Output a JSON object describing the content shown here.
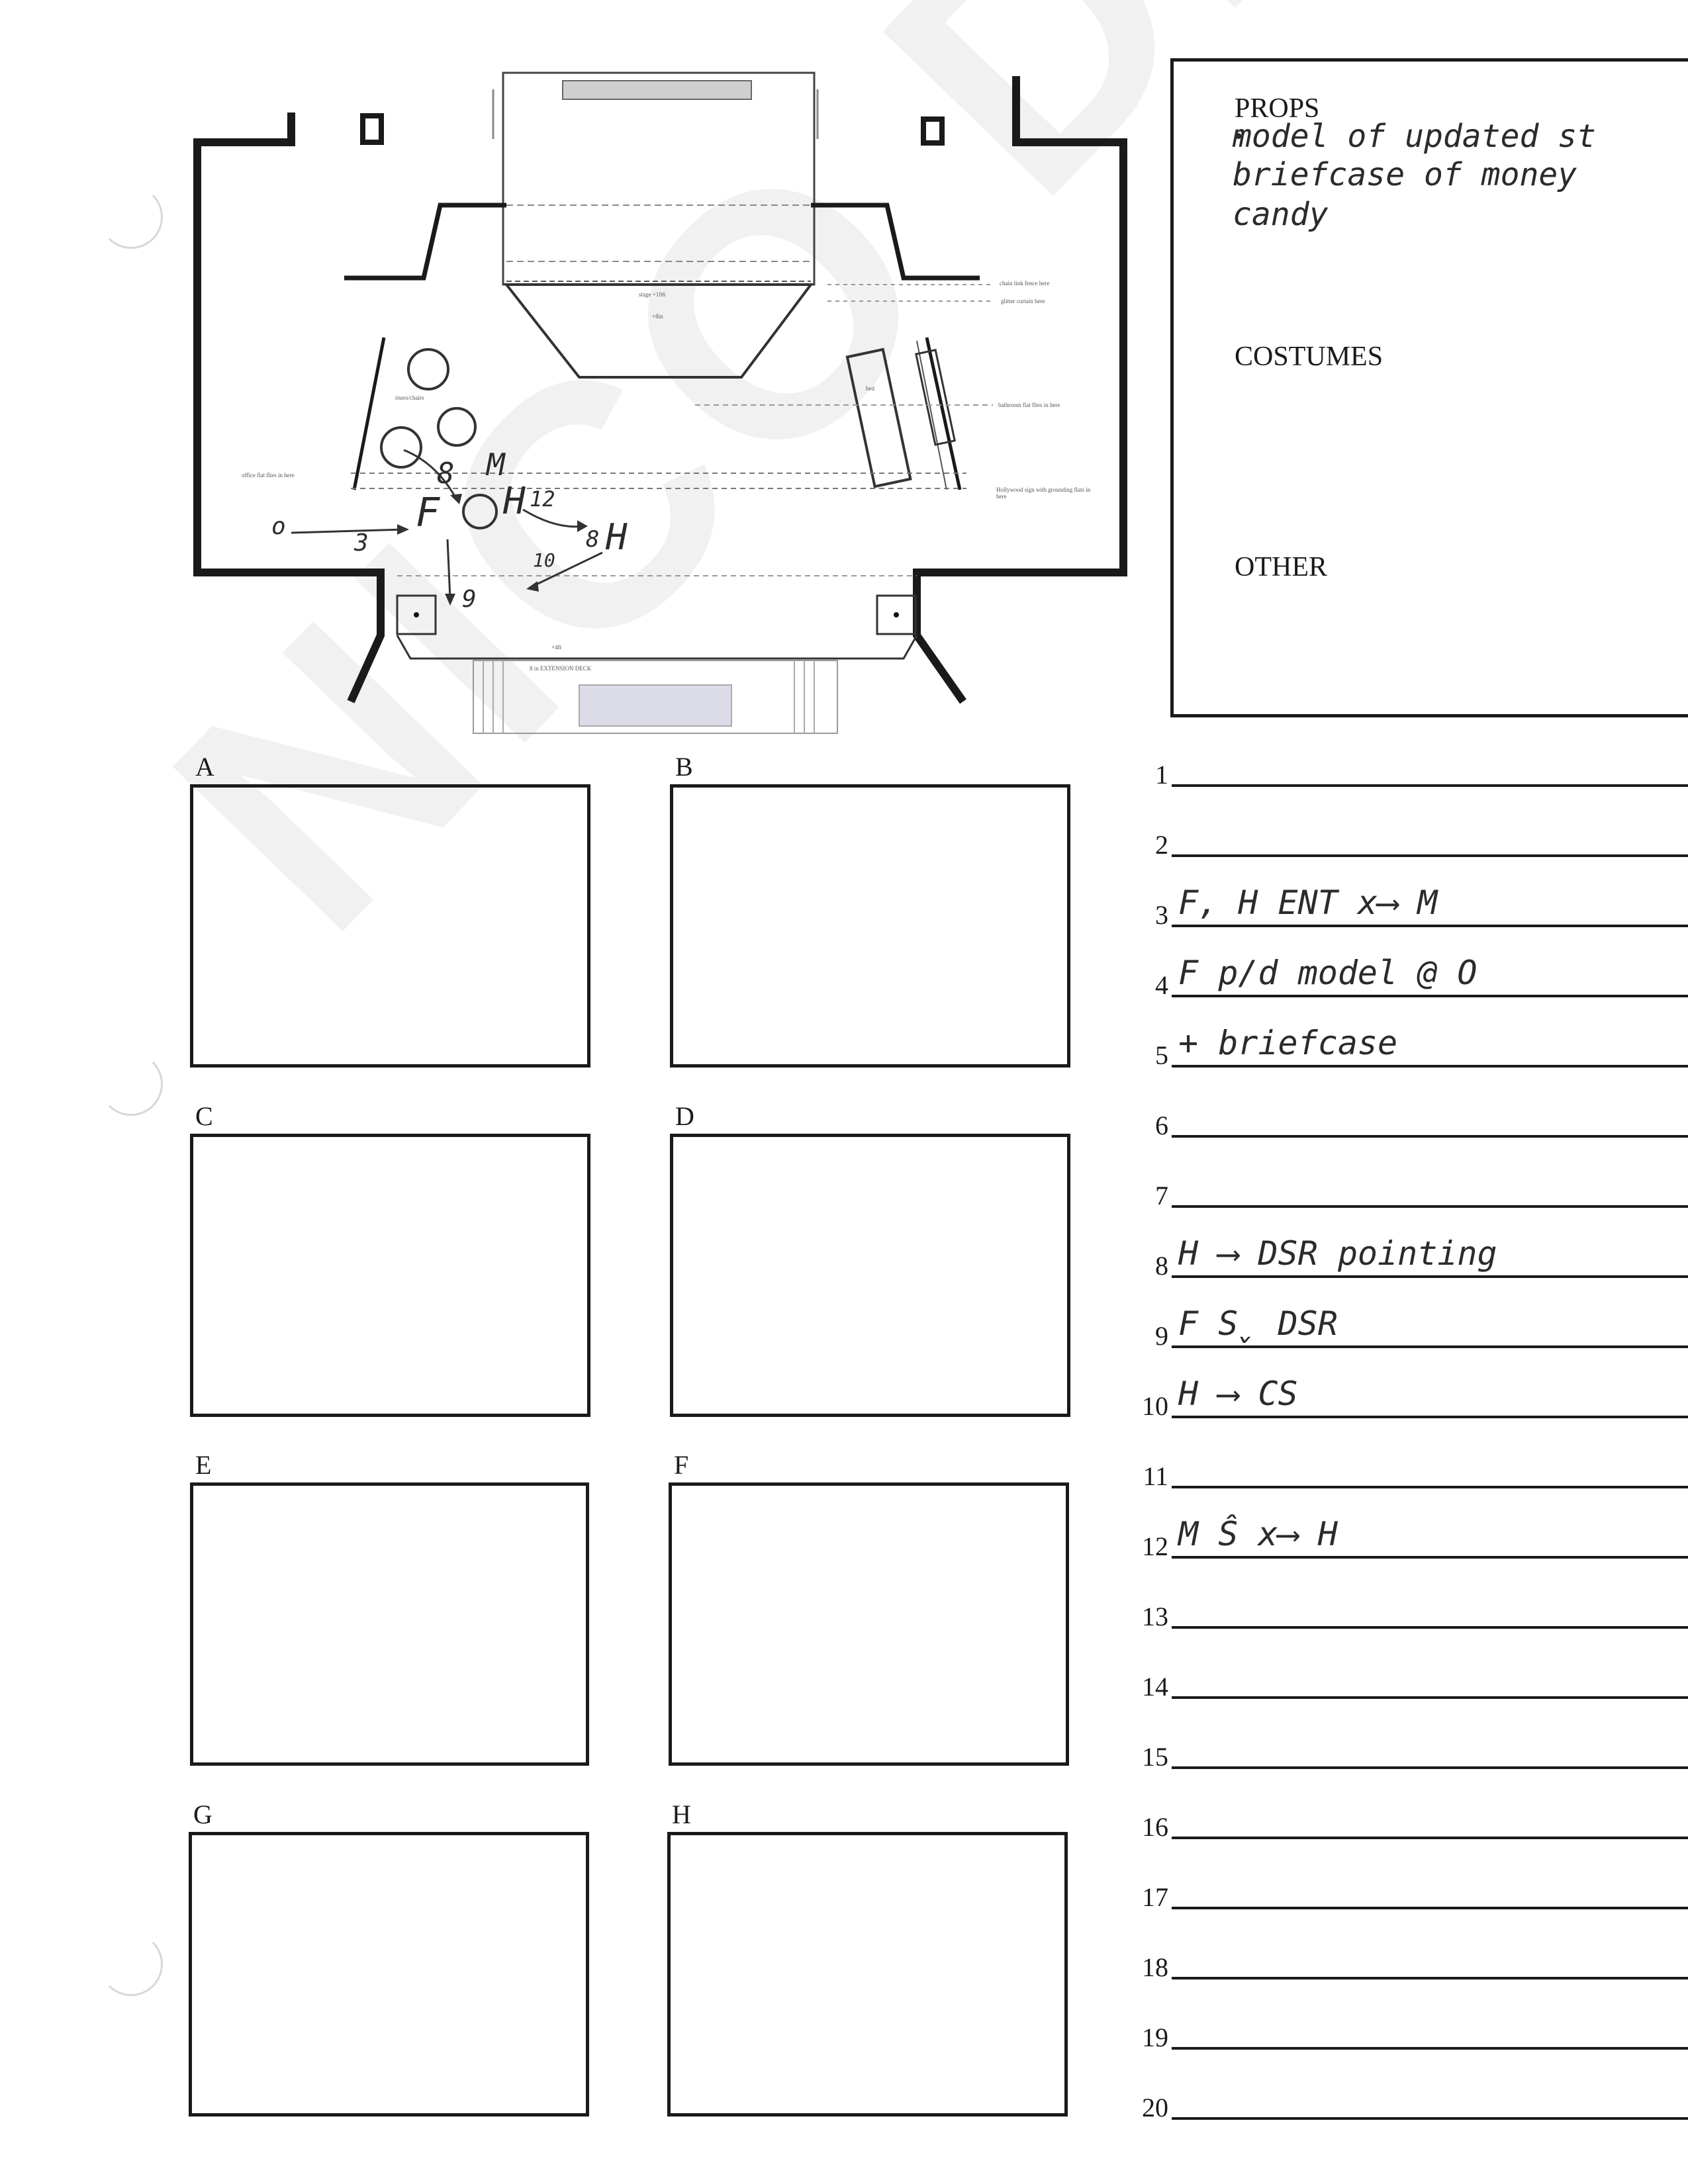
{
  "watermark": "NICO DICECCO",
  "stage_plan": {
    "labels": {
      "chain_link": "chain link fence here",
      "glitter": "glitter curtain here",
      "stage_label": "stage +1ft6",
      "plus_8": "+8in",
      "office_flat": "office flat flies in here",
      "bathroom_flat": "bathroom flat flies in here",
      "hollywood": "Hollywood sign with grounding flats in here",
      "bed": "bed",
      "risers": "risers/chairs",
      "plus_4": "+4ft",
      "extension": "8 in EXTENSION DECK"
    },
    "blocking": {
      "o_start": "o",
      "arrow_3": "3",
      "F": "F",
      "O": "O",
      "8_label": "8",
      "M": "M",
      "H_label": "H",
      "arrow_12": "12",
      "arrow_8": "8",
      "arrow_9": "9",
      "arrow_10": "10"
    }
  },
  "sidebar_box": {
    "props_title": "PROPS",
    "props_items": [
      "model of updated st",
      "briefcase of money",
      "candy"
    ],
    "costumes_title": "COSTUMES",
    "other_title": "OTHER"
  },
  "frames": [
    "A",
    "B",
    "C",
    "D",
    "E",
    "F",
    "G",
    "H"
  ],
  "lines": [
    {
      "num": "1",
      "text": ""
    },
    {
      "num": "2",
      "text": ""
    },
    {
      "num": "3",
      "text": "F, H      ENT  x⟶   M"
    },
    {
      "num": "4",
      "text": "F   p/d  model  @   O"
    },
    {
      "num": "5",
      "text": "+   briefcase"
    },
    {
      "num": "6",
      "text": ""
    },
    {
      "num": "7",
      "text": ""
    },
    {
      "num": "8",
      "text": "H ⟶ DSR   pointing"
    },
    {
      "num": "9",
      "text": "F  S̬   DSR"
    },
    {
      "num": "10",
      "text": "H  ⟶   CS"
    },
    {
      "num": "11",
      "text": ""
    },
    {
      "num": "12",
      "text": "M   Ŝ     x⟶    H"
    },
    {
      "num": "13",
      "text": ""
    },
    {
      "num": "14",
      "text": ""
    },
    {
      "num": "15",
      "text": ""
    },
    {
      "num": "16",
      "text": ""
    },
    {
      "num": "17",
      "text": ""
    },
    {
      "num": "18",
      "text": ""
    },
    {
      "num": "19",
      "text": ""
    },
    {
      "num": "20",
      "text": ""
    }
  ]
}
